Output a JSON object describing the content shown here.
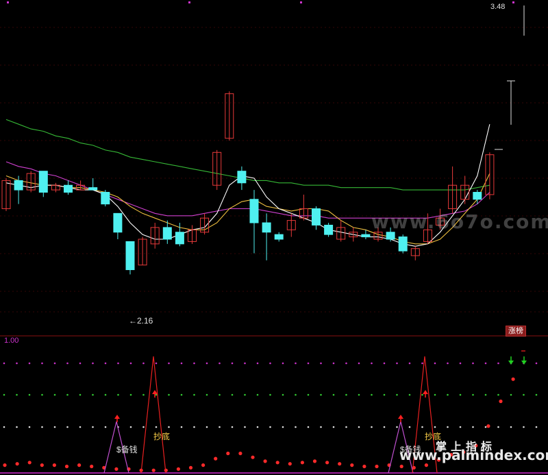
{
  "colors": {
    "background": "#000000",
    "bull": "#e83a3a",
    "bear": "#4ff0f0",
    "ma5": "#ffffff",
    "ma10": "#f0c040",
    "ma20": "#d040d0",
    "ma60": "#36b836",
    "signal_line": "#e82020",
    "signal_alt": "#c050d0",
    "grid_red": "#6a0c0c"
  },
  "main_chart": {
    "high_label": "3.48",
    "low_label": "2.16",
    "watermark": "www.6o7o.com",
    "candles": [
      {
        "o": 2.62,
        "c": 2.74,
        "h": 2.75,
        "l": 2.61
      },
      {
        "o": 2.74,
        "c": 2.7,
        "h": 2.76,
        "l": 2.64
      },
      {
        "o": 2.7,
        "c": 2.77,
        "h": 2.78,
        "l": 2.69
      },
      {
        "o": 2.78,
        "c": 2.69,
        "h": 2.78,
        "l": 2.67
      },
      {
        "o": 2.7,
        "c": 2.72,
        "h": 2.73,
        "l": 2.69
      },
      {
        "o": 2.72,
        "c": 2.69,
        "h": 2.74,
        "l": 2.68
      },
      {
        "o": 2.7,
        "c": 2.72,
        "h": 2.74,
        "l": 2.7
      },
      {
        "o": 2.71,
        "c": 2.7,
        "h": 2.75,
        "l": 2.7
      },
      {
        "o": 2.69,
        "c": 2.64,
        "h": 2.7,
        "l": 2.63
      },
      {
        "o": 2.6,
        "c": 2.52,
        "h": 2.6,
        "l": 2.49
      },
      {
        "o": 2.48,
        "c": 2.36,
        "h": 2.48,
        "l": 2.34
      },
      {
        "o": 2.38,
        "c": 2.49,
        "h": 2.5,
        "l": 2.38
      },
      {
        "o": 2.47,
        "c": 2.54,
        "h": 2.56,
        "l": 2.45
      },
      {
        "o": 2.54,
        "c": 2.49,
        "h": 2.57,
        "l": 2.47
      },
      {
        "o": 2.52,
        "c": 2.47,
        "h": 2.56,
        "l": 2.46
      },
      {
        "o": 2.48,
        "c": 2.53,
        "h": 2.55,
        "l": 2.47
      },
      {
        "o": 2.52,
        "c": 2.58,
        "h": 2.6,
        "l": 2.51
      },
      {
        "o": 2.72,
        "c": 2.86,
        "h": 2.87,
        "l": 2.7
      },
      {
        "o": 2.92,
        "c": 3.11,
        "h": 3.12,
        "l": 2.91
      },
      {
        "o": 2.78,
        "c": 2.73,
        "h": 2.8,
        "l": 2.7
      },
      {
        "o": 2.66,
        "c": 2.56,
        "h": 2.7,
        "l": 2.43
      },
      {
        "o": 2.56,
        "c": 2.52,
        "h": 2.6,
        "l": 2.4
      },
      {
        "o": 2.51,
        "c": 2.49,
        "h": 2.52,
        "l": 2.48
      },
      {
        "o": 2.53,
        "c": 2.57,
        "h": 2.6,
        "l": 2.5
      },
      {
        "o": 2.58,
        "c": 2.62,
        "h": 2.68,
        "l": 2.57
      },
      {
        "o": 2.62,
        "c": 2.55,
        "h": 2.63,
        "l": 2.53
      },
      {
        "o": 2.55,
        "c": 2.51,
        "h": 2.56,
        "l": 2.5
      },
      {
        "o": 2.49,
        "c": 2.54,
        "h": 2.57,
        "l": 2.48
      },
      {
        "o": 2.5,
        "c": 2.52,
        "h": 2.54,
        "l": 2.48
      },
      {
        "o": 2.51,
        "c": 2.5,
        "h": 2.53,
        "l": 2.49
      },
      {
        "o": 2.49,
        "c": 2.52,
        "h": 2.54,
        "l": 2.48
      },
      {
        "o": 2.52,
        "c": 2.49,
        "h": 2.54,
        "l": 2.48
      },
      {
        "o": 2.5,
        "c": 2.44,
        "h": 2.51,
        "l": 2.43
      },
      {
        "o": 2.42,
        "c": 2.45,
        "h": 2.46,
        "l": 2.4
      },
      {
        "o": 2.48,
        "c": 2.53,
        "h": 2.6,
        "l": 2.47
      },
      {
        "o": 2.55,
        "c": 2.58,
        "h": 2.62,
        "l": 2.53
      },
      {
        "o": 2.62,
        "c": 2.72,
        "h": 2.8,
        "l": 2.6
      },
      {
        "o": 2.66,
        "c": 2.72,
        "h": 2.76,
        "l": 2.64
      },
      {
        "o": 2.69,
        "c": 2.66,
        "h": 2.7,
        "l": 2.64
      },
      {
        "o": 2.68,
        "c": 2.85,
        "h": 2.86,
        "l": 2.66
      }
    ],
    "ma60": [
      3.0,
      2.98,
      2.96,
      2.95,
      2.93,
      2.92,
      2.9,
      2.89,
      2.87,
      2.86,
      2.84,
      2.83,
      2.82,
      2.81,
      2.8,
      2.79,
      2.78,
      2.77,
      2.76,
      2.75,
      2.74,
      2.74,
      2.73,
      2.73,
      2.72,
      2.72,
      2.72,
      2.71,
      2.71,
      2.71,
      2.71,
      2.71,
      2.7,
      2.7,
      2.7,
      2.7,
      2.7,
      2.7,
      2.71,
      2.72
    ],
    "ma20": [
      2.82,
      2.8,
      2.79,
      2.77,
      2.76,
      2.74,
      2.72,
      2.7,
      2.68,
      2.66,
      2.64,
      2.62,
      2.6,
      2.59,
      2.59,
      2.59,
      2.6,
      2.61,
      2.62,
      2.62,
      2.62,
      2.61,
      2.6,
      2.59,
      2.59,
      2.59,
      2.58,
      2.58,
      2.58,
      2.58,
      2.58,
      2.58,
      2.58,
      2.58,
      2.58,
      2.59,
      2.6,
      2.61,
      2.64,
      2.69
    ],
    "ma10": [
      2.76,
      2.74,
      2.73,
      2.72,
      2.72,
      2.71,
      2.71,
      2.7,
      2.69,
      2.67,
      2.63,
      2.6,
      2.58,
      2.56,
      2.54,
      2.53,
      2.53,
      2.56,
      2.62,
      2.65,
      2.66,
      2.63,
      2.62,
      2.61,
      2.62,
      2.62,
      2.61,
      2.57,
      2.54,
      2.53,
      2.51,
      2.5,
      2.48,
      2.47,
      2.47,
      2.49,
      2.54,
      2.6,
      2.66,
      2.77
    ],
    "ma5": [
      2.73,
      2.72,
      2.71,
      2.72,
      2.72,
      2.71,
      2.7,
      2.7,
      2.68,
      2.63,
      2.56,
      2.51,
      2.49,
      2.49,
      2.51,
      2.53,
      2.54,
      2.6,
      2.72,
      2.76,
      2.75,
      2.67,
      2.62,
      2.6,
      2.58,
      2.56,
      2.53,
      2.52,
      2.51,
      2.5,
      2.5,
      2.49,
      2.47,
      2.46,
      2.47,
      2.52,
      2.59,
      2.66,
      2.76,
      2.98
    ],
    "badge": "涨榜"
  },
  "indicator": {
    "max_label": "1.00",
    "signals": [
      {
        "text": "$备钱",
        "key": "beiqian_1"
      },
      {
        "text": "抄底",
        "key": "chaodi_1"
      },
      {
        "text": "$备钱",
        "key": "beiqian_2"
      },
      {
        "text": "抄底",
        "key": "chaodi_2"
      }
    ],
    "sig_beiqian_1": "$备钱",
    "sig_chaodi_1": "抄底",
    "sig_beiqian_2": "$备钱",
    "sig_chaodi_2": "抄底",
    "dots": [
      0.06,
      0.07,
      0.08,
      0.06,
      0.06,
      0.05,
      0.06,
      0.05,
      0.04,
      0.03,
      0.03,
      0.02,
      0.02,
      0.02,
      0.03,
      0.04,
      0.06,
      0.11,
      0.15,
      0.15,
      0.12,
      0.09,
      0.08,
      0.07,
      0.08,
      0.09,
      0.08,
      0.07,
      0.06,
      0.05,
      0.05,
      0.06,
      0.05,
      0.04,
      0.06,
      0.1,
      0.14,
      0.16,
      0.21,
      0.36,
      0.55,
      0.72
    ]
  },
  "watermarks": {
    "top": "www.6o7o.com",
    "bottom_cn": "掌上指标",
    "bottom_url": "www.palmindex.com"
  }
}
